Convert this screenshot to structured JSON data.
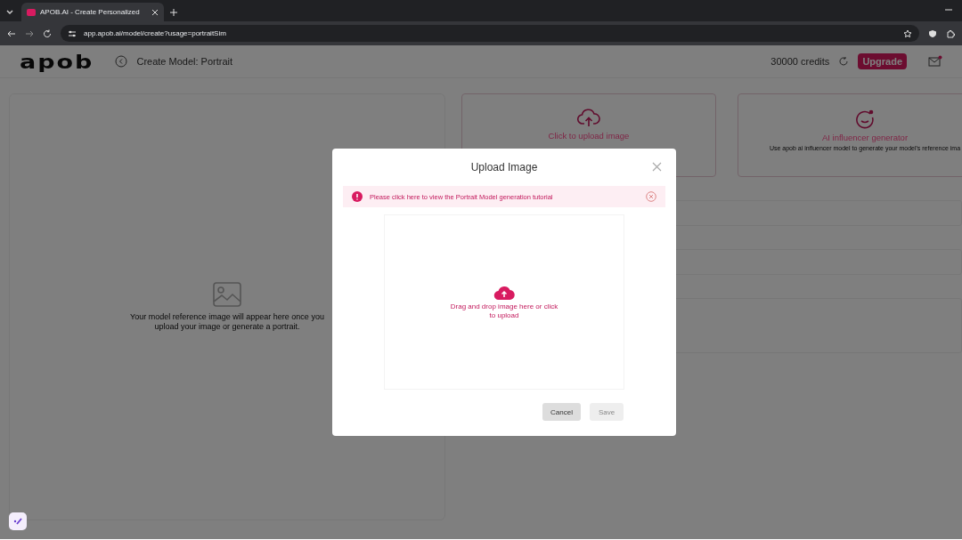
{
  "browser": {
    "tab_title": "APOB.AI - Create Personalized",
    "url": "app.apob.ai/model/create?usage=portraitSim"
  },
  "header": {
    "logo": "apob",
    "title": "Create Model: Portrait",
    "credits": "30000 credits",
    "upgrade": "Upgrade"
  },
  "preview": {
    "message": "Your model reference image will appear here once you upload your image or generate a portrait."
  },
  "options": [
    {
      "kind": "upload",
      "title": "Click to upload image"
    },
    {
      "kind": "generator",
      "title": "AI influencer generator",
      "description": "Use apob ai influencer model to generate your model's reference ima"
    }
  ],
  "dialog": {
    "title": "Upload Image",
    "notice": "Please click here to view the Portrait Model generation tutorial",
    "dropzone": "Drag and drop image here or click to upload",
    "buttons": [
      {
        "label": "Cancel",
        "disabled": false
      },
      {
        "label": "Save",
        "disabled": true
      }
    ]
  }
}
